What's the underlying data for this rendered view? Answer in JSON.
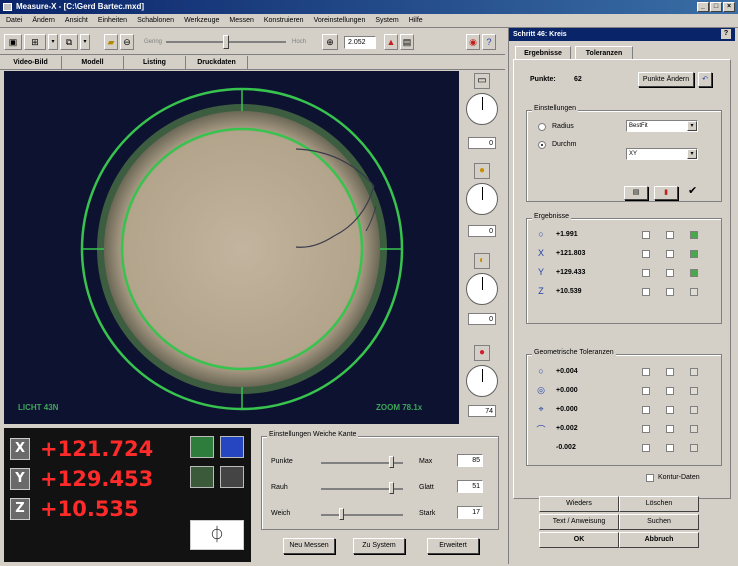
{
  "window": {
    "title": "Measure-X - [C:\\Gerd Bartec.mxd]",
    "controls": [
      "_",
      "□",
      "×"
    ]
  },
  "menu": [
    "Datei",
    "Ändern",
    "Ansicht",
    "Einheiten",
    "Schablonen",
    "Werkzeuge",
    "Messen",
    "Konstruieren",
    "Voreinstellungen",
    "System",
    "Hilfe"
  ],
  "toolbar": {
    "slider_left": "Gering",
    "slider_right": "Hoch",
    "zoom_value": "2.052"
  },
  "view_tabs": [
    "Video-Bild",
    "Modell",
    "Listing",
    "Druckdaten"
  ],
  "camera": {
    "light_label": "LICHT 43N",
    "zoom_label": "ZOOM 78.1x"
  },
  "side": {
    "box1": "0",
    "box2": "0",
    "box3": "0",
    "box4": "74"
  },
  "dro": {
    "x_axis": "X",
    "y_axis": "Y",
    "z_axis": "Z",
    "x_value": "+121.724",
    "y_value": "+129.453",
    "z_value": "+10.535"
  },
  "edge_settings": {
    "title": "Einstellungen Weiche Kante",
    "rows": [
      {
        "label": "Punkte",
        "right_label": "Max",
        "value": "85"
      },
      {
        "label": "Rauh",
        "right_label": "Glatt",
        "value": "51"
      },
      {
        "label": "Weich",
        "right_label": "Stark",
        "value": "17"
      }
    ],
    "buttons": [
      "Neu Messen",
      "Zu System",
      "Erweitert"
    ]
  },
  "right_panel": {
    "title": "Schritt 46: Kreis",
    "help": "?",
    "tabs": [
      "Ergebnisse",
      "Toleranzen"
    ],
    "points_label": "Punkte:",
    "points_value": "62",
    "points_button": "Punkte Ändern",
    "settings_title": "Einstellungen",
    "radius_label": "Radius",
    "diameter_label": "Durchm",
    "fit_value": "BestFit",
    "plane_value": "XY",
    "results_title": "Ergebnisse",
    "results": [
      {
        "icon": "○",
        "value": "+1.991"
      },
      {
        "icon": "X",
        "value": "+121.803"
      },
      {
        "icon": "Y",
        "value": "+129.433"
      },
      {
        "icon": "Z",
        "value": "+10.539"
      }
    ],
    "tol_title": "Geometrische Toleranzen",
    "tolerances": [
      {
        "icon": "○",
        "value": "+0.004"
      },
      {
        "icon": "◎",
        "value": "+0.000"
      },
      {
        "icon": "⌖",
        "value": "+0.000"
      },
      {
        "icon": "⌒",
        "value": "+0.002"
      },
      {
        "icon": "",
        "value": "-0.002"
      }
    ],
    "contour_label": "Kontur-Daten",
    "bottom_buttons": [
      "Wieders",
      "Löschen",
      "Text / Anweisung",
      "Suchen",
      "OK",
      "Abbruch"
    ]
  }
}
